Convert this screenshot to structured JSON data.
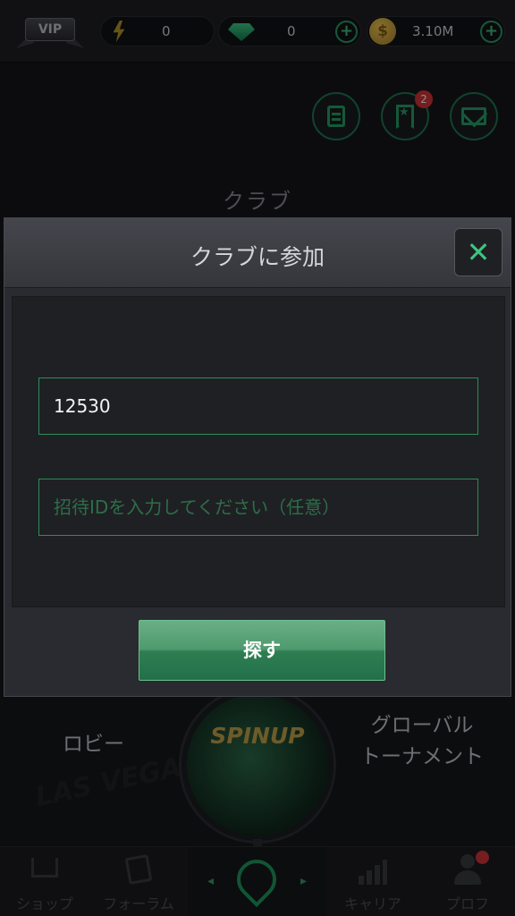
{
  "topbar": {
    "vip_label": "VIP",
    "energy_value": "0",
    "gem_value": "0",
    "coin_value": "3.10M",
    "plus_symbol": "+",
    "coin_symbol": "$"
  },
  "header": {
    "title": "クラブ",
    "bookmark_badge": "2"
  },
  "modal": {
    "title": "クラブに参加",
    "close_symbol": "✕",
    "club_id_value": "12530",
    "invite_id_placeholder": "招待IDを入力してください（任意）",
    "search_button_label": "探す"
  },
  "lobby": {
    "lobby_label": "ロビー",
    "global_tournament_label_line1": "グローバル",
    "global_tournament_label_line2": "トーナメント",
    "globe_logo": "SPINUP",
    "background_text": "LAS VEGAS"
  },
  "bottom_nav": {
    "items": [
      {
        "label": "ショップ",
        "icon": "cart-icon"
      },
      {
        "label": "フォーラム",
        "icon": "cards-icon"
      },
      {
        "label": "",
        "icon": "spade-icon"
      },
      {
        "label": "キャリア",
        "icon": "bar-chart-icon"
      },
      {
        "label": "プロフ",
        "icon": "profile-icon"
      }
    ],
    "left_arrow": "◂",
    "right_arrow": "▸"
  },
  "colors": {
    "accent": "#2fa56d",
    "badge": "#d8353a",
    "gold": "#c6a74b"
  }
}
